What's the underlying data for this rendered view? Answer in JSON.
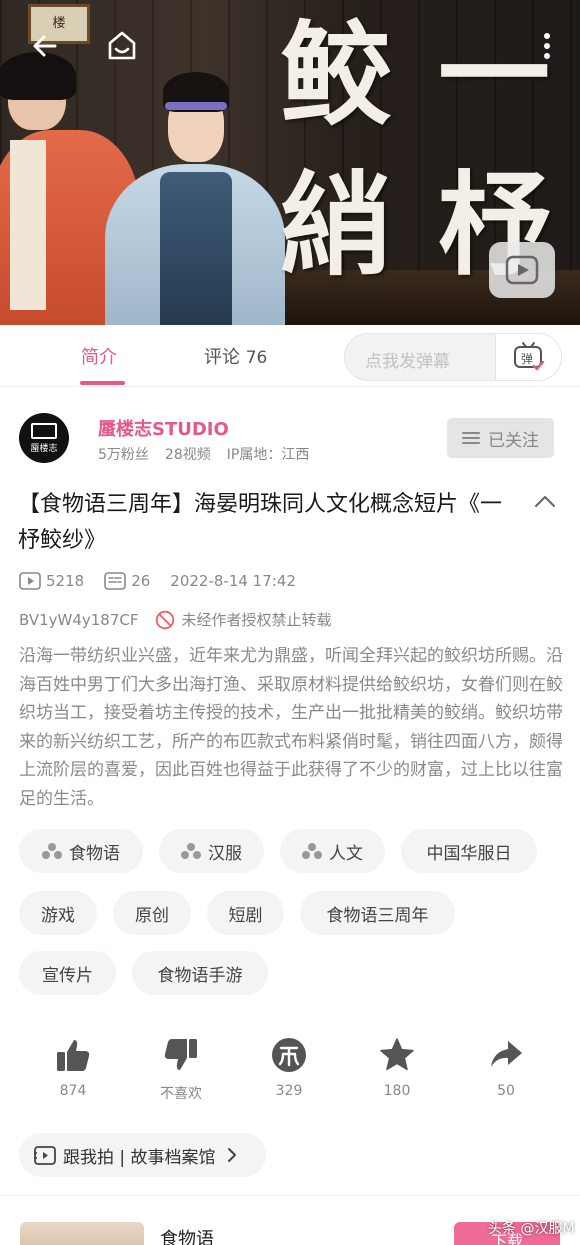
{
  "video": {
    "calligraphy": [
      "鲛",
      "一",
      "綃",
      "杼"
    ],
    "plaque": "楼"
  },
  "tabs": {
    "intro": "简介",
    "comments": "评论",
    "comments_count": "76",
    "danmu_placeholder": "点我发弹幕",
    "danmu_btn": "弹"
  },
  "uploader": {
    "name": "蜃楼志STUDIO",
    "fans": "5万粉丝",
    "videos": "28视频",
    "ip": "IP属地：江西",
    "follow_label": "已关注",
    "avatar_text": "蜃楼志"
  },
  "video_info": {
    "title": "【食物语三周年】海晏明珠同人文化概念短片《一杼鲛纱》",
    "plays": "5218",
    "danmaku": "26",
    "date": "2022-8-14 17:42",
    "bvid": "BV1yW4y187CF",
    "notice": "未经作者授权禁止转载",
    "description": "沿海一带纺织业兴盛，近年来尤为鼎盛，听闻全拜兴起的鲛织坊所赐。沿海百姓中男丁们大多出海打渔、采取原材料提供给鲛织坊，女眷们则在鲛织坊当工，接受着坊主传授的技术，生产出一批批精美的鲛绡。鲛织坊带来的新兴纺织工艺，所产的布匹款式布料紧俏时髦，销往四面八方，颇得上流阶层的喜爱，因此百姓也得益于此获得了不少的财富，过上比以往富足的生活。"
  },
  "tags": [
    "食物语",
    "汉服",
    "人文",
    "中国华服日",
    "游戏",
    "原创",
    "短剧",
    "食物语三周年",
    "宣传片",
    "食物语手游"
  ],
  "actions": {
    "like": "874",
    "dislike": "不喜欢",
    "coin": "329",
    "favorite": "180",
    "share": "50"
  },
  "follow_shoot": "跟我拍 | 故事档案馆",
  "related": {
    "name": "食物语",
    "download": "下载",
    "watermark": "头条 @汉服M"
  },
  "colors": {
    "accent": "#e6588b",
    "muted": "#888888"
  }
}
